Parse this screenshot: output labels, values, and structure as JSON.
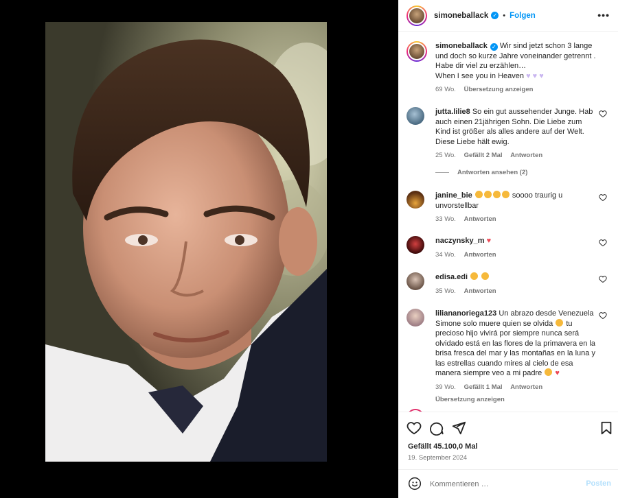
{
  "post": {
    "username": "simoneballack",
    "follow_label": "Folgen",
    "dot": "•",
    "more_label": "•••"
  },
  "caption": {
    "username": "simoneballack",
    "text": "Wir sind jetzt schon 3 lange und doch so kurze Jahre voneinander getrennt . Habe dir viel zu erzählen…",
    "text2": "When I see you in Heaven",
    "time": "69 Wo.",
    "translate": "Übersetzung anzeigen"
  },
  "comments": [
    {
      "username": "jutta.lilie8",
      "text": "So ein gut aussehender Junge. Hab auch einen 21jährigen Sohn. Die Liebe zum Kind ist größer als alles andere auf der Welt. Diese Liebe hält ewig.",
      "time": "25 Wo.",
      "likes": "Gefällt 2 Mal",
      "reply": "Antworten",
      "view_replies": "Antworten ansehen (2)"
    },
    {
      "username": "janine_bie",
      "text": "soooo traurig u unvorstellbar",
      "time": "33 Wo.",
      "reply": "Antworten"
    },
    {
      "username": "naczynsky_m",
      "text": "",
      "time": "34 Wo.",
      "reply": "Antworten"
    },
    {
      "username": "edisa.edi",
      "text": "",
      "time": "35 Wo.",
      "reply": "Antworten"
    },
    {
      "username": "lilianan­oriega123",
      "text": "Un abrazo desde Venezuela Simone solo muere quien se olvida",
      "text2": "tu precioso hijo vivirá por siempre nunca será olvidado está en las flores de la primavera en la brisa fresca del mar y las montañas en la luna y las estrellas cuando mires al cielo de esa manera siempre veo a mi padre",
      "time": "39 Wo.",
      "likes": "Gefällt 1 Mal",
      "reply": "Antworten",
      "translate": "Übersetzung anzeigen"
    }
  ],
  "footer": {
    "likes": "Gefällt 45.100,0 Mal",
    "date": "19. September 2024",
    "comment_placeholder": "Kommentieren …",
    "post_label": "Posten"
  },
  "colors": {
    "accent": "#0095f6",
    "heart_red": "#ed4956",
    "lilac": "#c9b6f0"
  }
}
